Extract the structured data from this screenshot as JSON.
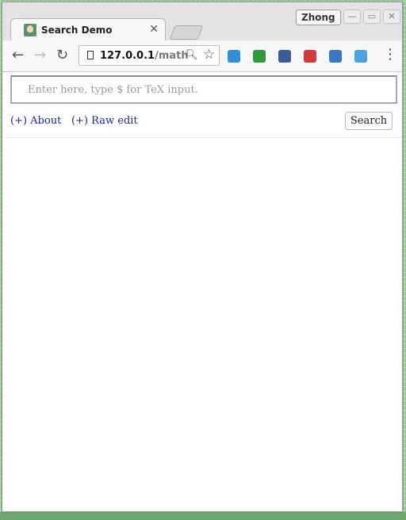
{
  "browser": {
    "tab_title": "Search Demo",
    "tab_close": "✕",
    "profile_name": "Zhong",
    "url_host": "127.0.0.1",
    "url_path": "/math",
    "extensions": [
      {
        "name": "swirl-extension",
        "color": "#2f8fd8"
      },
      {
        "name": "shield-extension",
        "color": "#2e9a3e"
      },
      {
        "name": "clock-extension",
        "color": "#3b5b9a"
      },
      {
        "name": "red-extension",
        "color": "#d23b3b"
      },
      {
        "name": "y-extension",
        "color": "#3a78c7"
      },
      {
        "name": "bird-extension",
        "color": "#4aa3df"
      }
    ]
  },
  "page": {
    "search_placeholder": "Enter here, type $ for TeX input.",
    "about_link": "(+) About",
    "raw_edit_link": "(+) Raw edit",
    "search_button": "Search"
  },
  "colors": {
    "link": "#2222aa",
    "desktop": "#8fc28f"
  }
}
